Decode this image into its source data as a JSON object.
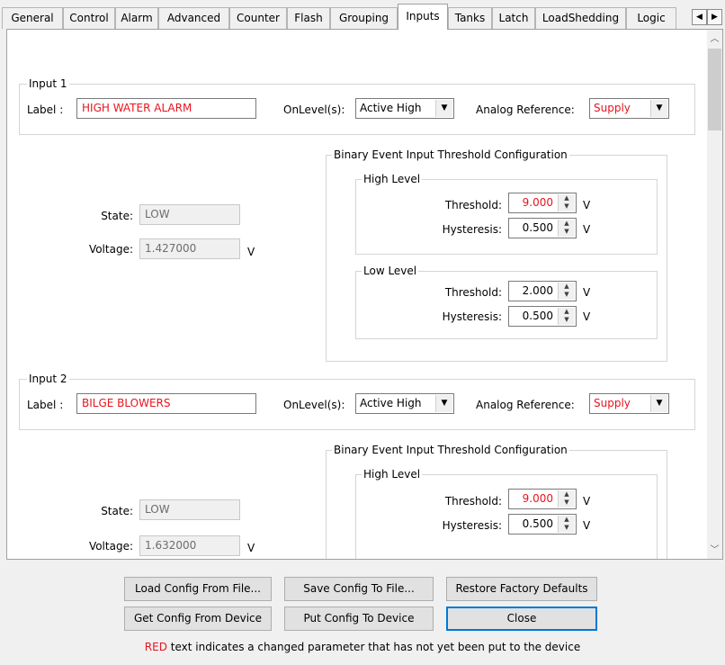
{
  "tabs": [
    "General",
    "Control",
    "Alarm",
    "Advanced",
    "Counter",
    "Flash",
    "Grouping",
    "Inputs",
    "Tanks",
    "Latch",
    "LoadShedding",
    "Logic"
  ],
  "active_tab": "Inputs",
  "labels": {
    "label": "Label :",
    "onlevel": "OnLevel(s):",
    "analog_ref": "Analog Reference:",
    "state": "State:",
    "voltage": "Voltage:",
    "volt_unit": "V",
    "binary_config": "Binary Event Input Threshold Configuration",
    "high_level": "High Level",
    "low_level": "Low Level",
    "threshold": "Threshold:",
    "hysteresis": "Hysteresis:"
  },
  "input1": {
    "title": "Input 1",
    "label_value": "HIGH WATER ALARM",
    "onlevel": "Active High",
    "analog_ref": "Supply",
    "state": "LOW",
    "voltage": "1.427000",
    "high_threshold": "9.000",
    "high_hysteresis": "0.500",
    "low_threshold": "2.000",
    "low_hysteresis": "0.500"
  },
  "input2": {
    "title": "Input 2",
    "label_value": "BILGE BLOWERS",
    "onlevel": "Active High",
    "analog_ref": "Supply",
    "state": "LOW",
    "voltage": "1.632000",
    "high_threshold": "9.000",
    "high_hysteresis": "0.500"
  },
  "buttons": {
    "load_file": "Load Config From File...",
    "save_file": "Save Config To File...",
    "restore": "Restore Factory Defaults",
    "get_device": "Get Config From Device",
    "put_device": "Put Config To Device",
    "close": "Close"
  },
  "note": {
    "red_word": "RED",
    "text": " text indicates a changed parameter that has not yet been put to the device"
  },
  "colors": {
    "changed": "#e8141e",
    "accent": "#0078d7"
  }
}
